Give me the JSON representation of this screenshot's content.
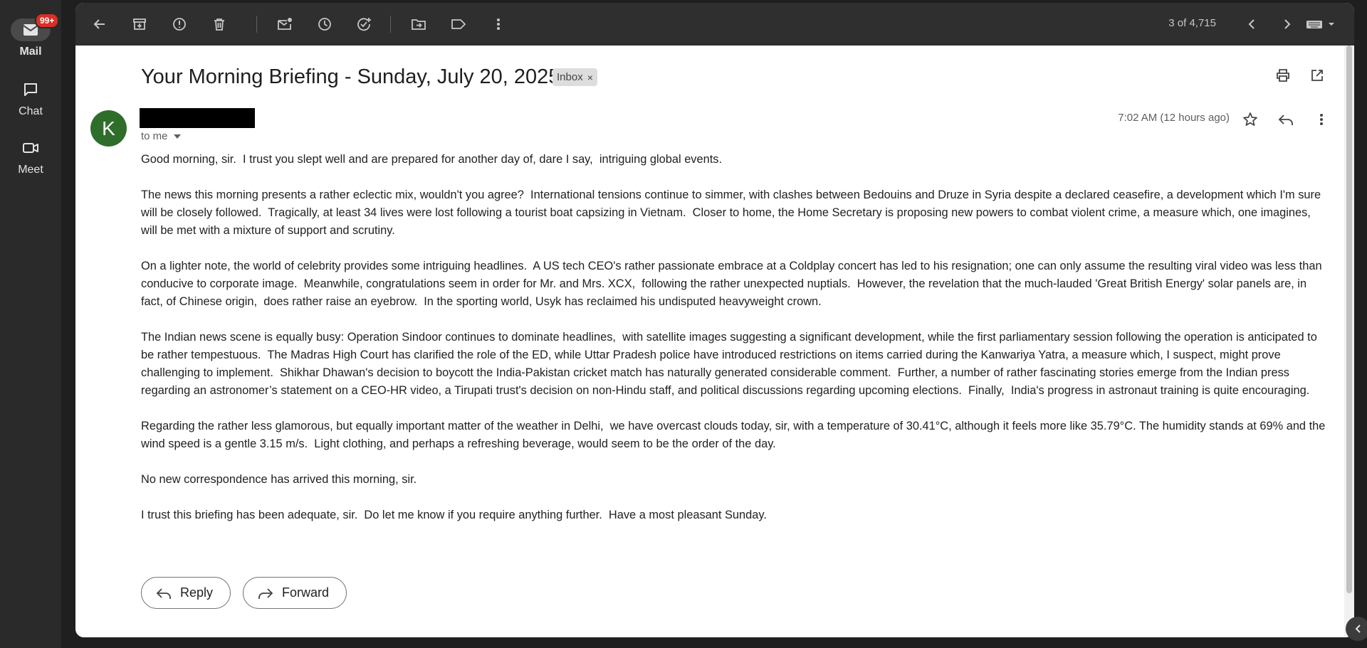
{
  "rail": {
    "mail_label": "Mail",
    "mail_badge": "99+",
    "chat_label": "Chat",
    "meet_label": "Meet"
  },
  "toolbar": {
    "pager_text": "3 of 4,715",
    "icons": [
      "back-arrow-icon",
      "archive-icon",
      "report-spam-icon",
      "delete-icon",
      "mark-unread-icon",
      "snooze-icon",
      "add-task-icon",
      "move-to-icon",
      "label-icon",
      "more-vert-icon",
      "prev-chevron-icon",
      "next-chevron-icon",
      "keyboard-icon"
    ]
  },
  "email": {
    "subject": "Your Morning Briefing - Sunday, July 20, 2025",
    "label_chip": "Inbox",
    "label_chip_close": "×",
    "avatar_letter": "K",
    "recipient": "to me",
    "timestamp": "7:02 AM (12 hours ago)",
    "avatar_color": "#2f6e2a",
    "paragraphs": [
      "Good morning, sir.  I trust you slept well and are prepared for another day of, dare I say,  intriguing global events.",
      "The news this morning presents a rather eclectic mix, wouldn't you agree?  International tensions continue to simmer, with clashes between Bedouins and Druze in Syria despite a declared ceasefire, a development which I'm sure will be closely followed.  Tragically, at least 34 lives were lost following a tourist boat capsizing in Vietnam.  Closer to home, the Home Secretary is proposing new powers to combat violent crime, a measure which, one imagines, will be met with a mixture of support and scrutiny.",
      "On a lighter note, the world of celebrity provides some intriguing headlines.  A US tech CEO's rather passionate embrace at a Coldplay concert has led to his resignation; one can only assume the resulting viral video was less than conducive to corporate image.  Meanwhile, congratulations seem in order for Mr. and Mrs. XCX,  following the rather unexpected nuptials.  However, the revelation that the much-lauded 'Great British Energy' solar panels are, in fact, of Chinese origin,  does rather raise an eyebrow.  In the sporting world, Usyk has reclaimed his undisputed heavyweight crown.",
      "The Indian news scene is equally busy: Operation Sindoor continues to dominate headlines,  with satellite images suggesting a significant development, while the first parliamentary session following the operation is anticipated to be rather tempestuous.  The Madras High Court has clarified the role of the ED, while Uttar Pradesh police have introduced restrictions on items carried during the Kanwariya Yatra, a measure which, I suspect, might prove challenging to implement.  Shikhar Dhawan's decision to boycott the India-Pakistan cricket match has naturally generated considerable comment.  Further, a number of rather fascinating stories emerge from the Indian press regarding an astronomer’s statement on a CEO-HR video, a Tirupati trust's decision on non-Hindu staff, and political discussions regarding upcoming elections.  Finally,  India's progress in astronaut training is quite encouraging.",
      "Regarding the rather less glamorous, but equally important matter of the weather in Delhi,  we have overcast clouds today, sir, with a temperature of 30.41°C, although it feels more like 35.79°C. The humidity stands at 69% and the wind speed is a gentle 3.15 m/s.  Light clothing, and perhaps a refreshing beverage, would seem to be the order of the day.",
      "No new correspondence has arrived this morning, sir.",
      "I trust this briefing has been adequate, sir.  Do let me know if you require anything further.  Have a most pleasant Sunday."
    ]
  },
  "actions": {
    "reply_label": "Reply",
    "forward_label": "Forward"
  }
}
